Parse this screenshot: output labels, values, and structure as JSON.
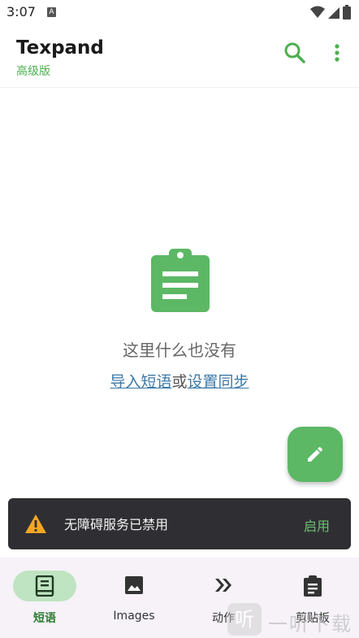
{
  "status_bar": {
    "time": "3:07",
    "notification_icon": "A"
  },
  "app_bar": {
    "title": "Texpand",
    "subtitle": "高级版"
  },
  "empty_state": {
    "message": "这里什么也没有",
    "import_link": "导入短语",
    "separator": "或",
    "sync_link": "设置同步"
  },
  "snackbar": {
    "message": "无障碍服务已禁用",
    "action": "启用"
  },
  "bottom_nav": {
    "items": [
      {
        "label": "短语",
        "icon": "book-icon",
        "active": true
      },
      {
        "label": "Images",
        "icon": "image-icon",
        "active": false
      },
      {
        "label": "动作",
        "icon": "double-chevron-icon",
        "active": false
      },
      {
        "label": "剪贴板",
        "icon": "clipboard-icon",
        "active": false
      }
    ]
  },
  "watermark": {
    "badge": "听",
    "text": "一听下载"
  },
  "colors": {
    "accent": "#4caf50",
    "fab": "#5cb865",
    "link": "#3b78a8",
    "snackbar_bg": "#2f2f33",
    "warning": "#f5a623"
  }
}
